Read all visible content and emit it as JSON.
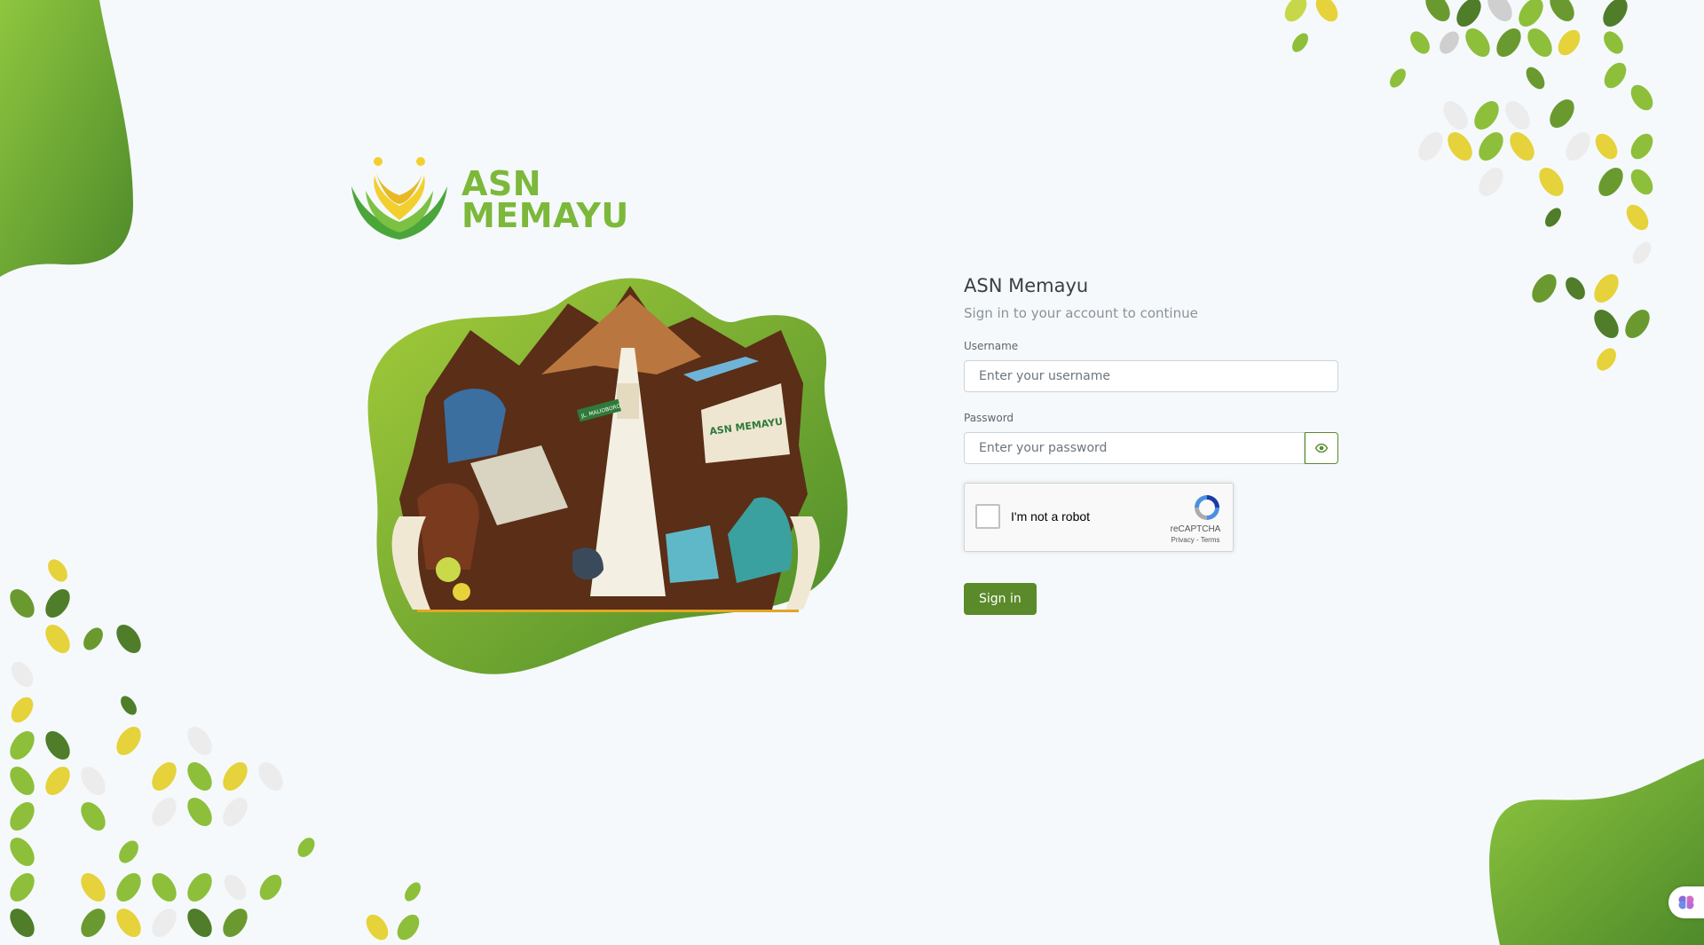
{
  "brand": {
    "logo_line1": "ASN",
    "logo_line2": "MEMAYU",
    "logo_color": "#7cb83a"
  },
  "hero": {
    "banner_text": "ASN MEMAYU",
    "sign_text": "JL. MALIOBORO"
  },
  "login": {
    "title": "ASN Memayu",
    "subtitle": "Sign in to your account to continue",
    "username_label": "Username",
    "username_placeholder": "Enter your username",
    "username_value": "",
    "password_label": "Password",
    "password_placeholder": "Enter your password",
    "password_value": "",
    "toggle_icon": "eye-icon",
    "submit_label": "Sign in",
    "accent_color": "#5a8a2a"
  },
  "captcha": {
    "checkbox_label": "I'm not a robot",
    "brand": "reCAPTCHA",
    "links": "Privacy - Terms",
    "checked": false
  },
  "widget": {
    "icon": "brain-icon"
  }
}
